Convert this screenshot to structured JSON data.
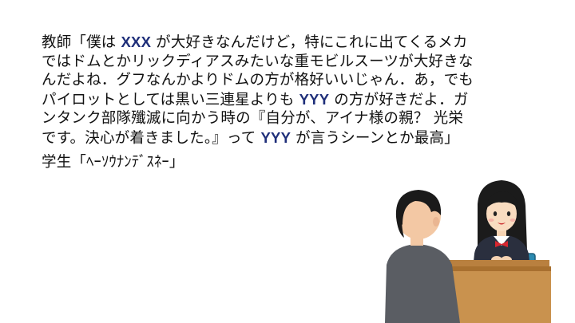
{
  "teacher": {
    "line1_a": "教師「僕は",
    "placeholder_1": "XXX",
    "line1_b": "が大好きなんだけど，特にこれに出てくるメカ",
    "line2": "ではドムとかリックディアスみたいな重モビルスーツが大好きな",
    "line3": "んだよね．グフなんかよりドムの方が格好いいじゃん．あ，でも",
    "line4_a": "パイロットとしては黒い三連星よりも",
    "placeholder_2": "YYY",
    "line4_b": "の方が好きだよ．ガ",
    "line5": "ンタンク部隊殲滅に向かう時の『自分が、アイナ様の親？ 光栄",
    "line6_a": "です。決心が着きました。』って",
    "placeholder_3": "YYY",
    "line6_b": "が言うシーンとか最高」"
  },
  "student": {
    "line": "学生「ﾍｰｿｳﾅﾝﾃﾞｽﾈｰ」"
  },
  "colors": {
    "placeholder": "#1f2f7a",
    "text": "#111111",
    "desk": "#c9924e",
    "chair": "#2b8ab0"
  },
  "illustration": {
    "description_icon": "teacher-student-desk-illustration"
  }
}
